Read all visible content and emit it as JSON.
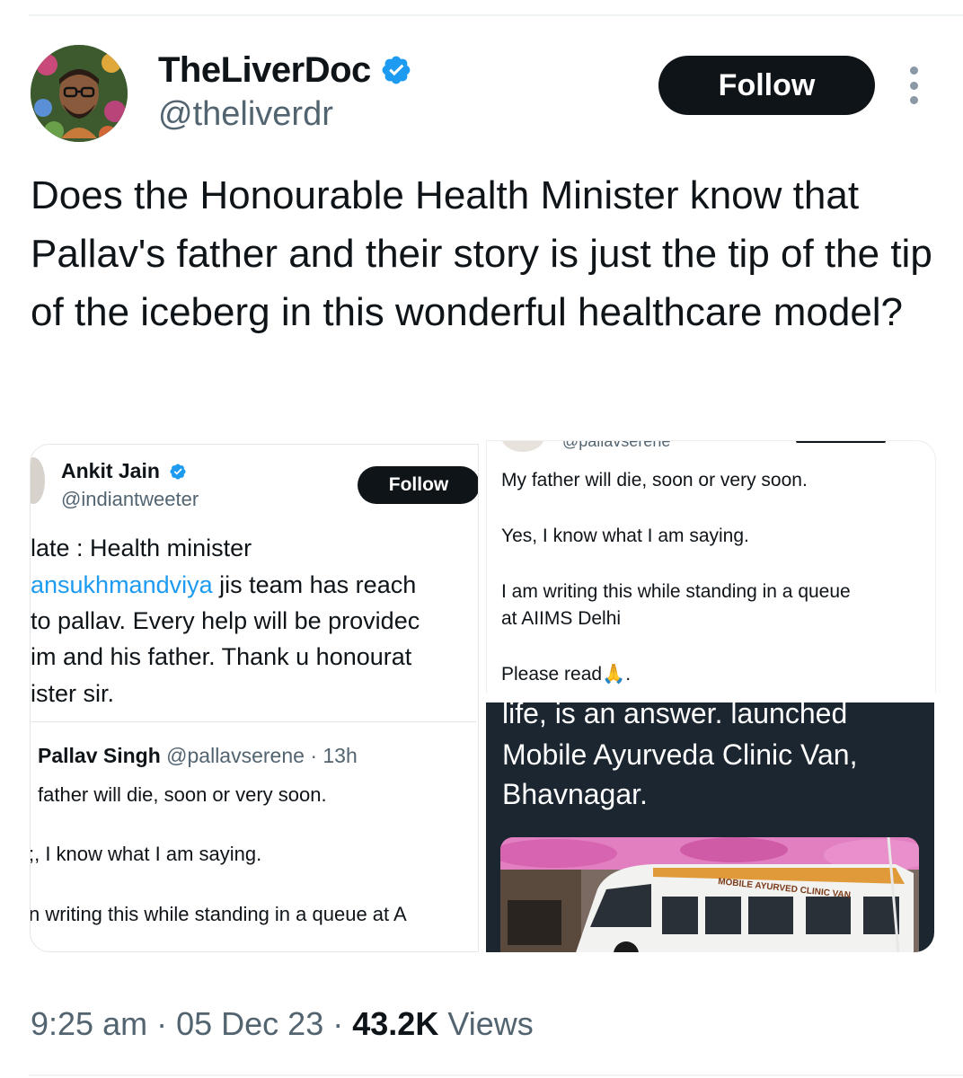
{
  "author": {
    "name": "TheLiverDoc",
    "handle": "@theliverdr",
    "follow_label": "Follow"
  },
  "tweet": {
    "text": "Does the Honourable Health Minister know that Pallav's father and their story is just the tip of the tip of the iceberg in this wonderful healthcare model?"
  },
  "meta": {
    "time": "9:25 am",
    "sep": "·",
    "date": "05 Dec 23",
    "views_count": "43.2K",
    "views_label": "Views"
  },
  "left_screenshot": {
    "name": "Ankit Jain",
    "handle": "@indiantweeter",
    "follow_label": "Follow",
    "lines": {
      "l1": "late : Health minister",
      "l2_mention": "ansukhmandviya",
      "l2_rest": " jis team has reach",
      "l3": "to pallav. Every help will be providec",
      "l4": "im and his father. Thank u honourat",
      "l5": "ister sir."
    },
    "quote": {
      "name": "Pallav Singh",
      "handle": "@pallavserene",
      "time": "· 13h",
      "q1": "father will die, soon or very soon.",
      "q2": ";, I know what I am saying.",
      "q3": "n writing this while standing in a queue at A"
    }
  },
  "right_screenshot": {
    "handle_partial": "@pallavserene",
    "r1": "My father will die, soon or very soon.",
    "r2": "Yes, I know what I am saying.",
    "r3": "I am writing this while standing in a queue",
    "r4": "at AIIMS Delhi",
    "r5": "Please read🙏.",
    "dark1": "life, is an answer. launched",
    "dark2": "Mobile Ayurveda Clinic Van,",
    "dark3": "Bhavnagar.",
    "van_sign": "MOBILE AYURVED CLINIC VAN"
  },
  "colors": {
    "accent": "#1d9bf0",
    "text": "#0f1419",
    "secondary": "#536471",
    "button": "#0f1419",
    "dark_panel": "#1b2630"
  },
  "icons": [
    "verified-badge-icon",
    "more-options-icon"
  ]
}
